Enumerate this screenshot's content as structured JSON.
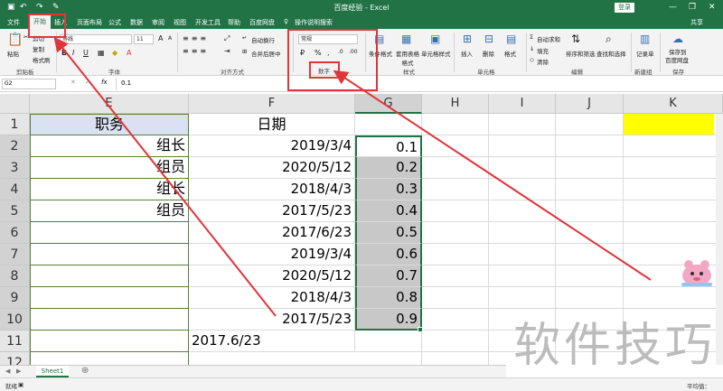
{
  "titlebar": {
    "title": "百度经验 - Excel",
    "login_label": "登录",
    "window_icons": [
      "save-icon",
      "undo-icon",
      "redo-icon",
      "format-painter-icon",
      "minimize-icon",
      "restore-icon",
      "close-icon"
    ]
  },
  "tabs": {
    "items": [
      "文件",
      "开始",
      "插入",
      "页面布局",
      "公式",
      "数据",
      "审阅",
      "视图",
      "开发工具",
      "帮助",
      "百度网盘",
      "操作说明搜索"
    ],
    "active": "开始",
    "share_label": "共享"
  },
  "ribbon": {
    "clipboard": {
      "paste": "粘贴",
      "cut": "剪切",
      "copy": "复制",
      "painter": "格式刷",
      "group": "剪贴板"
    },
    "font": {
      "name": "等线",
      "size": "11",
      "bold": "B",
      "italic": "I",
      "underline": "U",
      "grow": "A",
      "shrink": "A",
      "group": "字体"
    },
    "alignment": {
      "wrap": "自动换行",
      "merge": "合并后居中",
      "group": "对齐方式"
    },
    "number": {
      "format": "常规",
      "percent": "%",
      "comma": ",",
      "group": "数字"
    },
    "styles": {
      "conditional": "条件格式",
      "table": "套用表格格式",
      "cell_styles": "单元格样式",
      "group": "样式"
    },
    "cells": {
      "insert": "插入",
      "delete": "删除",
      "format": "格式",
      "group": "单元格"
    },
    "editing": {
      "autosum": "自动求和",
      "fill": "填充",
      "clear": "清除",
      "sort": "排序和筛选",
      "find": "查找和选择",
      "group": "编辑"
    },
    "new_group": {
      "record": "记录单",
      "group": "新建组"
    },
    "save": {
      "label1": "保存到",
      "label2": "百度网盘",
      "group": "保存"
    }
  },
  "formula_bar": {
    "name_box": "G2",
    "fx": "fx",
    "value": "0.1"
  },
  "columns": [
    "E",
    "F",
    "G",
    "H",
    "I",
    "J",
    "K"
  ],
  "rows": [
    "1",
    "2",
    "3",
    "4",
    "5",
    "6",
    "7",
    "8",
    "9",
    "10",
    "11",
    "12"
  ],
  "cells": {
    "E1": "职务",
    "F1": "日期",
    "E2": "组长",
    "F2": "2019/3/4",
    "G2": "0.1",
    "E3": "组员",
    "F3": "2020/5/12",
    "G3": "0.2",
    "E4": "组长",
    "F4": "2018/4/3",
    "G4": "0.3",
    "E5": "组员",
    "F5": "2017/5/23",
    "G5": "0.4",
    "F6": "2017/6/23",
    "G6": "0.5",
    "F7": "2019/3/4",
    "G7": "0.6",
    "F8": "2020/5/12",
    "G8": "0.7",
    "F9": "2018/4/3",
    "G9": "0.8",
    "F10": "2017/5/23",
    "G10": "0.9",
    "F11": "2017.6/23"
  },
  "sheet_tab": "Sheet1",
  "status": {
    "ready": "就绪",
    "average": "平均值："
  },
  "watermark": "软件技巧",
  "colors": {
    "excel_green": "#217346",
    "annotation_red": "#e0353a",
    "highlight_yellow": "#ffff00",
    "selection_gray": "#c8c8c8"
  }
}
